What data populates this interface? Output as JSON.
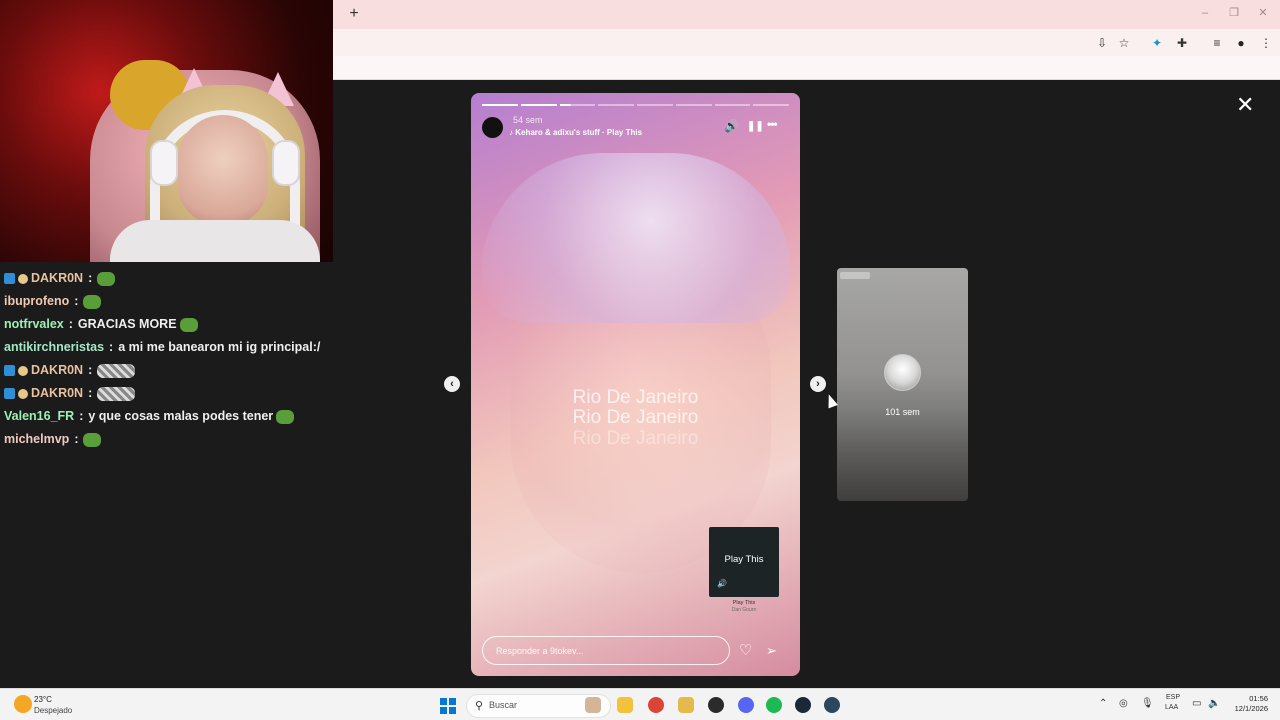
{
  "browser": {
    "new_tab_symbol": "+",
    "window_controls": {
      "minimize": "–",
      "maximize": "❐",
      "close": "✕"
    },
    "toolbar_icons": [
      "install-icon",
      "star-icon",
      "extension-colored-icon",
      "puzzle-icon",
      "media-icon",
      "profile-icon",
      "menu-icon"
    ],
    "toolbar_glyphs": {
      "install": "⇩",
      "star": "☆",
      "ext": "✦",
      "puzzle": "✚",
      "media": "≡",
      "profile": "●",
      "menu": "⋮"
    }
  },
  "chat": {
    "messages": [
      {
        "user": "DAKR0N",
        "user_color": "#e8c1a0",
        "text": "",
        "badges": true,
        "emote": "green"
      },
      {
        "user": "ibuprofeno",
        "user_color": "#efc9b0",
        "text": "",
        "badges": false,
        "emote": "green"
      },
      {
        "user": "notfrvalex",
        "user_color": "#9ef0b4",
        "text": "GRACIAS MORE",
        "badges": false,
        "emote": "green"
      },
      {
        "user": "antikirchneristas",
        "user_color": "#a6e6c6",
        "text": "a mi me banearon mi ig principal:/",
        "badges": false,
        "emote": ""
      },
      {
        "user": "DAKR0N",
        "user_color": "#e8c1a0",
        "text": "",
        "badges": true,
        "emote": "gray"
      },
      {
        "user": "DAKR0N",
        "user_color": "#e8c1a0",
        "text": "",
        "badges": true,
        "emote": "gray"
      },
      {
        "user": "Valen16_FR",
        "user_color": "#9ef0b4",
        "text": "y que cosas malas podes tener",
        "badges": false,
        "emote": "green"
      },
      {
        "user": "michelmvp",
        "user_color": "#f0c8c0",
        "text": "",
        "badges": false,
        "emote": "green"
      }
    ],
    "separator": ":"
  },
  "story": {
    "time_ago": "54 sem",
    "music_label": "Keharo & adixu's stuff · Play This",
    "music_glyph": "♪",
    "progress_segments_total": 8,
    "progress_segments_done": 2,
    "progress_current_fraction": 0.3,
    "overlay_lines": [
      "Rio De Janeiro",
      "Rio De Janeiro",
      "Rio De Janeiro"
    ],
    "music_card": {
      "title": "Play This",
      "caption_title": "Play This",
      "caption_artist": "Dan Gourn",
      "icon": "🔊"
    },
    "reply_placeholder": "Responder a 9tokev...",
    "icons": {
      "sound": "🔊",
      "pause": "❚❚",
      "more": "•••",
      "like": "♡",
      "share": "➢"
    }
  },
  "nav": {
    "prev": "‹",
    "next": "›",
    "close": "✕"
  },
  "next_story": {
    "time_ago": "101 sem"
  },
  "taskbar": {
    "weather": {
      "temp": "23°C",
      "desc": "Despejado"
    },
    "search_placeholder": "Buscar",
    "search_icon": "⚲",
    "apps": [
      {
        "name": "file-explorer",
        "color": "#f3c13a"
      },
      {
        "name": "chrome",
        "color": "#db4437"
      },
      {
        "name": "folder",
        "color": "#e6b94d"
      },
      {
        "name": "obs",
        "color": "#2b2b2b"
      },
      {
        "name": "discord",
        "color": "#5865f2"
      },
      {
        "name": "spotify",
        "color": "#1db954"
      },
      {
        "name": "steam",
        "color": "#1b2838"
      },
      {
        "name": "steam-2",
        "color": "#2a475e"
      }
    ],
    "tray_glyphs": {
      "chevron": "⌃",
      "network": "◎",
      "mic": "🎙",
      "screen": "▭",
      "volume": "🔈"
    },
    "language": [
      "ESP",
      "LAA"
    ],
    "clock": {
      "time": "01:56",
      "date": "12/1/2026"
    }
  }
}
